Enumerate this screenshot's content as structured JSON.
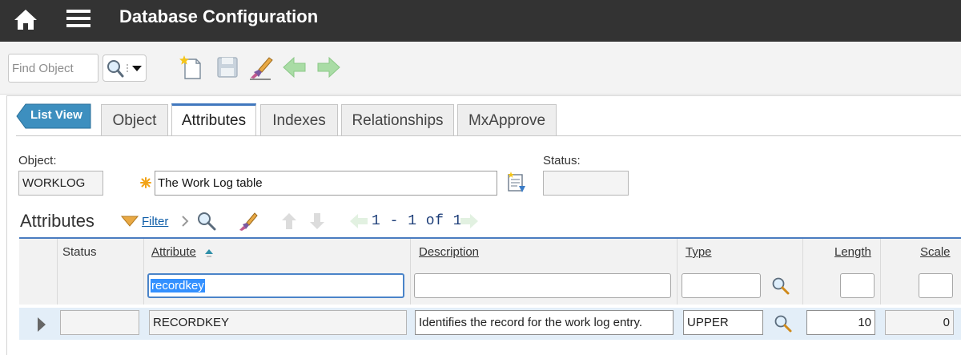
{
  "header": {
    "title": "Database Configuration",
    "home_icon": "home-icon",
    "menu_icon": "hamburger-menu-icon"
  },
  "toolbar": {
    "find_placeholder": "Find Object",
    "find_icon": "magnifier-icon",
    "icons": [
      "new-record-icon",
      "save-icon",
      "clear-changes-icon",
      "previous-record-icon",
      "next-record-icon"
    ]
  },
  "nav": {
    "list_view_label": "List View"
  },
  "tabs": [
    {
      "label": "Object",
      "active": false
    },
    {
      "label": "Attributes",
      "active": true
    },
    {
      "label": "Indexes",
      "active": false
    },
    {
      "label": "Relationships",
      "active": false
    },
    {
      "label": "MxApprove",
      "active": false
    }
  ],
  "object": {
    "object_label": "Object:",
    "object_value": "WORKLOG",
    "description_value": "The Work Log table",
    "status_label": "Status:",
    "status_value": ""
  },
  "attributes": {
    "section_title": "Attributes",
    "filter_label": "Filter",
    "pager_text": "1 - 1 of 1",
    "columns": {
      "status": "Status",
      "attribute": "Attribute",
      "description": "Description",
      "type": "Type",
      "length": "Length",
      "scale": "Scale"
    },
    "filters": {
      "attribute": "recordkey",
      "description": "",
      "type": "",
      "length": "",
      "scale": ""
    },
    "rows": [
      {
        "status": "",
        "attribute": "RECORDKEY",
        "description": "Identifies the record for the work log entry.",
        "type": "UPPER",
        "length": "10",
        "scale": "0"
      }
    ]
  },
  "colors": {
    "title_bar": "#333333",
    "accent": "#4178be",
    "list_view_button": "#3d8fbf",
    "selected_row": "#e3eef8",
    "nav_arrows": "#9fd69b"
  }
}
